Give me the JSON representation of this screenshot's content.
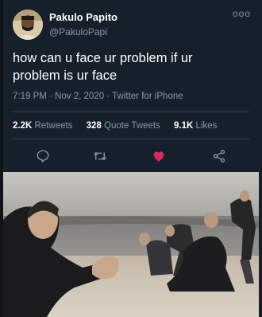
{
  "tweet": {
    "display_name": "Pakulo Papito",
    "handle": "@PakuloPapi",
    "more_label": "ooo",
    "text_line1": "how can u face ur problem if ur",
    "text_line2": "problem is ur face",
    "time": "7:19 PM",
    "date": "Nov 2, 2020",
    "source": "Twitter for iPhone",
    "separator": "·"
  },
  "stats": {
    "retweets_count": "2.2K",
    "retweets_label": "Retweets",
    "quotes_count": "328",
    "quotes_label": "Quote Tweets",
    "likes_count": "9.1K",
    "likes_label": "Likes"
  },
  "actions": {
    "reply_icon": "reply-icon",
    "retweet_icon": "retweet-icon",
    "like_icon": "heart-icon",
    "share_icon": "share-icon"
  },
  "colors": {
    "background": "#15202b",
    "secondary_text": "#8899a6",
    "divider": "#38444d",
    "like": "#e0245e"
  }
}
